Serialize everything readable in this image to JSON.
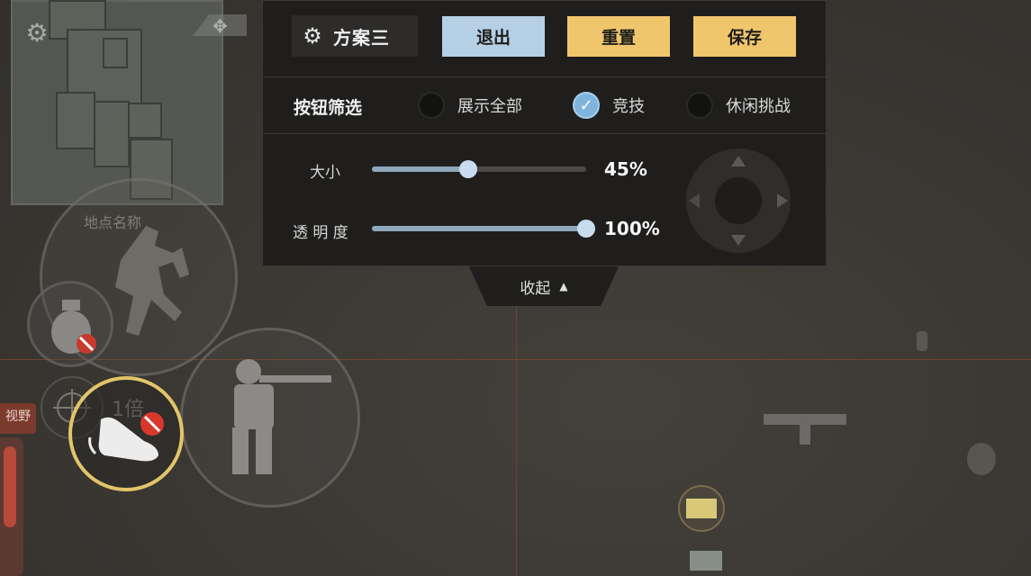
{
  "panel": {
    "scheme_name": "方案三",
    "buttons": {
      "exit": "退出",
      "reset": "重置",
      "save": "保存"
    },
    "filter": {
      "label": "按钮筛选",
      "options": [
        {
          "label": "展示全部",
          "checked": false
        },
        {
          "label": "竞技",
          "checked": true
        },
        {
          "label": "休闲挑战",
          "checked": false
        }
      ]
    },
    "sliders": {
      "size": {
        "label": "大小",
        "value_text": "45%",
        "value": 0.45
      },
      "opacity": {
        "label": "透 明 度",
        "value_text": "100%",
        "value": 1.0
      }
    },
    "collapse_label": "收起"
  },
  "hud": {
    "location_label": "地点名称",
    "zoom_label": "1倍",
    "side_label": "视野"
  },
  "colors": {
    "accent_blue": "#b5cfe4",
    "accent_gold": "#f0c66c",
    "panel_bg": "#1f1e1c",
    "guide_line": "#8a4a2e"
  },
  "icons": {
    "settings": "gear-icon",
    "check": "check-icon",
    "collapse": "triangle-up-icon"
  }
}
